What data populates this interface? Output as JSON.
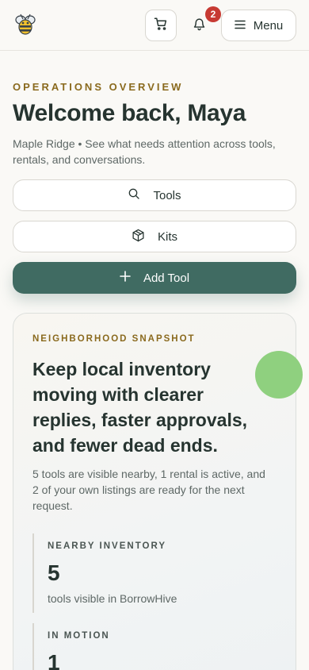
{
  "header": {
    "logo_icon": "bee-icon",
    "cart_icon": "cart-icon",
    "bell_icon": "bell-icon",
    "notification_count": "2",
    "menu_label": "Menu",
    "menu_icon": "hamburger-icon"
  },
  "intro": {
    "eyebrow": "OPERATIONS OVERVIEW",
    "title": "Welcome back, Maya",
    "subtitle": "Maple Ridge • See what needs attention across tools, rentals, and conversations."
  },
  "actions": {
    "tools_label": "Tools",
    "tools_icon": "search-icon",
    "kits_label": "Kits",
    "kits_icon": "package-icon",
    "add_label": "Add Tool",
    "add_icon": "plus-icon"
  },
  "snapshot": {
    "eyebrow": "NEIGHBORHOOD SNAPSHOT",
    "headline": "Keep local inventory moving with clearer replies, faster approvals, and fewer dead ends.",
    "body": "5 tools are visible nearby, 1 rental is active, and 2 of your own listings are ready for the next request.",
    "stats": [
      {
        "label": "NEARBY INVENTORY",
        "value": "5",
        "caption": "tools visible in BorrowHive"
      },
      {
        "label": "IN MOTION",
        "value": "1",
        "caption": ""
      }
    ]
  },
  "colors": {
    "accent": "#406b62",
    "eyebrow": "#8a6a1e",
    "badge": "#c73a33",
    "text": "#263430"
  }
}
